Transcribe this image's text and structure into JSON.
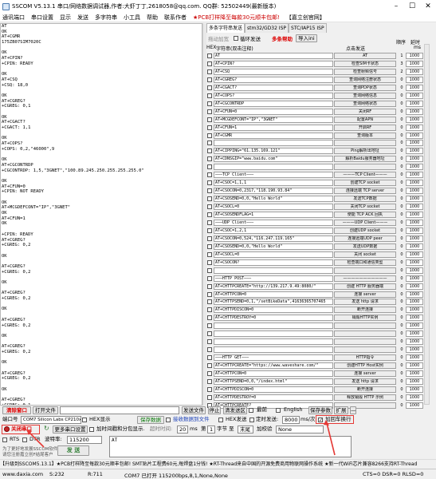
{
  "title": "SSCOM V5.13.1 串口/网络数据调试器,作者:大虾丁丁,2618058@qq.com. QQ群: 52502449(最新版本)",
  "menu": [
    "通讯端口",
    "串口设置",
    "显示",
    "发送",
    "多字符串",
    "小工具",
    "帮助",
    "联系作者",
    "★PCB打样降至每款30元顺丰包邮!",
    "【嘉立创官网】"
  ],
  "terminal_lines": [
    "AT",
    "OK",
    "AT+CGMR",
    "175ZB07SIM7020C",
    "",
    "OK",
    "AT+CPIN?",
    "+CPIN: READY",
    "",
    "OK",
    "AT+CSQ",
    "+CSQ: 18,0",
    "",
    "OK",
    "AT+CGREG?",
    "+CGREG: 0,1",
    "",
    "OK",
    "AT+CGACT?",
    "+CGACT: 1,1",
    "",
    "OK",
    "AT+COPS?",
    "+COPS: 0,2,\"46000\",9",
    "",
    "OK",
    "AT+CGCONTRDP",
    "+CGCONTRDP: 1,5,\"3GNET\",\"100.89.245.250.255.255.255.0\"",
    "",
    "OK",
    "AT+CFUN=0",
    "+CPIN: NOT READY",
    "",
    "OK",
    "AT+MCGDEFCONT=\"IP\",\"3GNET\"",
    "OK",
    "AT+CFUN=1",
    "OK",
    "",
    "+CPIN: READY",
    "AT+CGREG?",
    "+CGREG: 0,2",
    "",
    "OK",
    "",
    "AT+CGREG?",
    "+CGREG: 0,2",
    "",
    "OK",
    "",
    "AT+CGREG?",
    "+CGREG: 0,2",
    "",
    "OK",
    "",
    "AT+CGREG?",
    "+CGREG: 0,2",
    "",
    "OK",
    "",
    "AT+CGREG?",
    "+CGREG: 0,2",
    "",
    "OK",
    "",
    "AT+CGREG?",
    "+CGREG: 0,2",
    "",
    "OK",
    "",
    "AT+CGREG?",
    "+CGREG: 0,1",
    "",
    "OK",
    "AT+CGACT?",
    "+CGACT: 1,1",
    "",
    "OK"
  ],
  "right_panel": {
    "tabs": [
      "多条字符串发送",
      "stm32/GD32 ISP",
      "STC/IAP15 ISP"
    ],
    "opt_tuodong": "拖动加宽",
    "opt_loop": "循环发送",
    "opt_help": "多条帮助",
    "opt_import": "导入ini",
    "hdr_hex": "HEX",
    "hdr_str": "字符串(双击注释)",
    "hdr_send": "点击发送",
    "hdr_order": "顺序",
    "hdr_delay": "延时",
    "hdr_ms": "ms",
    "commands": [
      {
        "text": "AT",
        "label": "AT",
        "idx": "1",
        "delay": "1000"
      },
      {
        "text": "AT+CPIN?",
        "label": "检查SIM卡状态",
        "idx": "3",
        "delay": "1000"
      },
      {
        "text": "AT+CSQ",
        "label": "检查射频信号",
        "idx": "2",
        "delay": "1000"
      },
      {
        "text": "AT+CGREG?",
        "label": "查询网络注册状态",
        "idx": "0",
        "delay": "1000"
      },
      {
        "text": "AT+CGACT?",
        "label": "查询PDP状态",
        "idx": "0",
        "delay": "1000"
      },
      {
        "text": "AT+COPS?",
        "label": "查询网络信息",
        "idx": "0",
        "delay": "1000"
      },
      {
        "text": "AT+CGCONTRDP",
        "label": "查询网络状态",
        "idx": "0",
        "delay": "1000"
      },
      {
        "text": "AT+CFUN=0",
        "label": "关闭RF",
        "idx": "0",
        "delay": "1000"
      },
      {
        "text": "AT+MCGDEFCONT=\"IP\",\"3GNET\"",
        "label": "配置APN",
        "idx": "0",
        "delay": "1000"
      },
      {
        "text": "AT+CFUN=1",
        "label": "开启RF",
        "idx": "0",
        "delay": "1000"
      },
      {
        "text": "AT+CGMR",
        "label": "查询版本",
        "idx": "0",
        "delay": "1000"
      },
      {
        "text": "",
        "label": "",
        "idx": "0",
        "delay": "1000"
      },
      {
        "text": "AT+CIPPING=\"61.135.169.121\"",
        "label": "Ping解析出地址",
        "idx": "0",
        "delay": "1000"
      },
      {
        "text": "AT+CDNSGIP=\"www.baidu.com\"",
        "label": "解析Baidu服务器地址",
        "idx": "0",
        "delay": "1000"
      },
      {
        "text": "",
        "label": "",
        "idx": "0",
        "delay": "1000"
      },
      {
        "text": "———TCP Client———",
        "label": "———TCP Client———",
        "idx": "0",
        "delay": "1000"
      },
      {
        "text": "AT+CSOC=1,1,1",
        "label": "创建TCP socket",
        "idx": "0",
        "delay": "1000"
      },
      {
        "text": "AT+CSOCON=0,2317,\"118.190.93.84\"",
        "label": "连接远端 TCP server",
        "idx": "0",
        "delay": "1000"
      },
      {
        "text": "AT+CSOSEND=0,0,\"Hello World\"",
        "label": "发送TCP数据",
        "idx": "0",
        "delay": "1000"
      },
      {
        "text": "AT+CSOCL=0",
        "label": "关闭TCP socket",
        "idx": "0",
        "delay": "1000"
      },
      {
        "text": "AT+CSOSENDFLAG=1",
        "label": "使能 TCP ACK 回执",
        "idx": "0",
        "delay": "1000"
      },
      {
        "text": "———UDP Client———",
        "label": "———UDP Client———",
        "idx": "0",
        "delay": "1000"
      },
      {
        "text": "AT+CSOC=1,2,1",
        "label": "创建UDP socket",
        "idx": "0",
        "delay": "1000"
      },
      {
        "text": "AT+CSOCON=0,524,\"116.247.119.165\"",
        "label": "连接远端UDP peer",
        "idx": "0",
        "delay": "1000"
      },
      {
        "text": "AT+CSOSEND=0,0,\"Hello World\"",
        "label": "发送UDP数据",
        "idx": "0",
        "delay": "1000"
      },
      {
        "text": "AT+CSOCL=0",
        "label": "关闭 socket",
        "idx": "0",
        "delay": "1000"
      },
      {
        "text": "AT+CSOCON?",
        "label": "检查端口和通信类型",
        "idx": "0",
        "delay": "1000"
      },
      {
        "text": "",
        "label": "",
        "idx": "0",
        "delay": "1000"
      },
      {
        "text": "———HTTP POST———",
        "label": "———————————",
        "idx": "0",
        "delay": "1000"
      },
      {
        "text": "AT+CHTTPCREATE=\"http://139.217.9.49:8080/\"",
        "label": "创建 HTTP 服务器端",
        "idx": "0",
        "delay": "1000"
      },
      {
        "text": "AT+CHTTPCON=0",
        "label": "连接 server",
        "idx": "0",
        "delay": "1000"
      },
      {
        "text": "AT+CHTTPSEND=0,1,\"/setBikeData\",41636365707465",
        "label": "发送 http 请求",
        "idx": "0",
        "delay": "1000"
      },
      {
        "text": "AT+CHTTPDISCON=0",
        "label": "断开连接",
        "idx": "0",
        "delay": "1000"
      },
      {
        "text": "AT+CHTTPDESTROY=0",
        "label": "销毁HTTP实例",
        "idx": "0",
        "delay": "1000"
      },
      {
        "text": "",
        "label": "",
        "idx": "0",
        "delay": "1000"
      },
      {
        "text": "",
        "label": "",
        "idx": "0",
        "delay": "1000"
      },
      {
        "text": "",
        "label": "",
        "idx": "0",
        "delay": "1000"
      },
      {
        "text": "",
        "label": "",
        "idx": "0",
        "delay": "1000"
      },
      {
        "text": "———HTTP GET———",
        "label": "HTTP指令",
        "idx": "0",
        "delay": "1000"
      },
      {
        "text": "AT+CHTTPCREATE=\"https://www.waveshare.com/\"",
        "label": "创建HTTP Host实例",
        "idx": "0",
        "delay": "1000"
      },
      {
        "text": "AT+CHTTPCON=0",
        "label": "连接 server",
        "idx": "0",
        "delay": "1000"
      },
      {
        "text": "AT+CHTTPSEND=0,0,\"/index.html\"",
        "label": "发送 http 请求",
        "idx": "0",
        "delay": "1000"
      },
      {
        "text": "AT+CHTTPDISCON=0",
        "label": "断开连接",
        "idx": "0",
        "delay": "1000"
      },
      {
        "text": "AT+CHTTPDESTROY=0",
        "label": "释放销毁 HTTP 示例",
        "idx": "0",
        "delay": "1000"
      },
      {
        "text": "AT+CHTTPCREATE?",
        "label": "",
        "idx": "0",
        "delay": "1000"
      }
    ]
  },
  "bottom": {
    "clear_window": "清除窗口",
    "open_file": "打开文件",
    "send_file": "发送文件",
    "stop": "停止",
    "clear_send": "清发送区",
    "latest": "最前",
    "english": "English",
    "save_params": "保存参数",
    "expand": "扩展",
    "dash": "—",
    "port_label": "端口号",
    "port_value": "COM7 Silicon Labs CP210x U",
    "hex_display": "HEX显示",
    "save_data": "保存数据",
    "recv_to_file": "接收数据到文件",
    "hex_send": "HEX发送",
    "timed_send": "定时发送:",
    "timed_value": "8000",
    "timed_unit": "ms/次",
    "add_crlf": "加回车换行",
    "close_port": "关闭串口",
    "more_settings": "更多串口设置",
    "add_timestamp": "加时间戳和分包显示.",
    "timeout_label": "超时时间:",
    "timeout_value": "20",
    "ms": "ms",
    "byte_label": "第",
    "byte_value": "1",
    "byte_to": "字节 至",
    "end_label": "末尾",
    "verify_label": "加校验",
    "verify_value": "None",
    "rts": "RTS",
    "dtr": "DTR",
    "baud_label": "波特率:",
    "baud_value": "115200",
    "send_area": "AT",
    "send_btn": "发 送",
    "promo1": "为了更好地发展SSCOM软件",
    "promo2": "请您注册嘉立创F结尾客户",
    "marquee": "【升级到SSCOM5.13.1】★PCB打样降至每款30元顺丰包邮! SMT贴片工程费60元,每焊盘1分钱! ★RT-Thread来自中国的开源免费商用物联网操作系统 ★新一代WiFi芯片兼容8266支持RT-Thread"
  },
  "status": {
    "website": "www.daxia.com",
    "s": "S:232",
    "r": "R:711",
    "port_info": "COM7 已打开  115200bps,8,1,None,None",
    "signals": "CTS=0 DSR=0 RLSD=0"
  }
}
